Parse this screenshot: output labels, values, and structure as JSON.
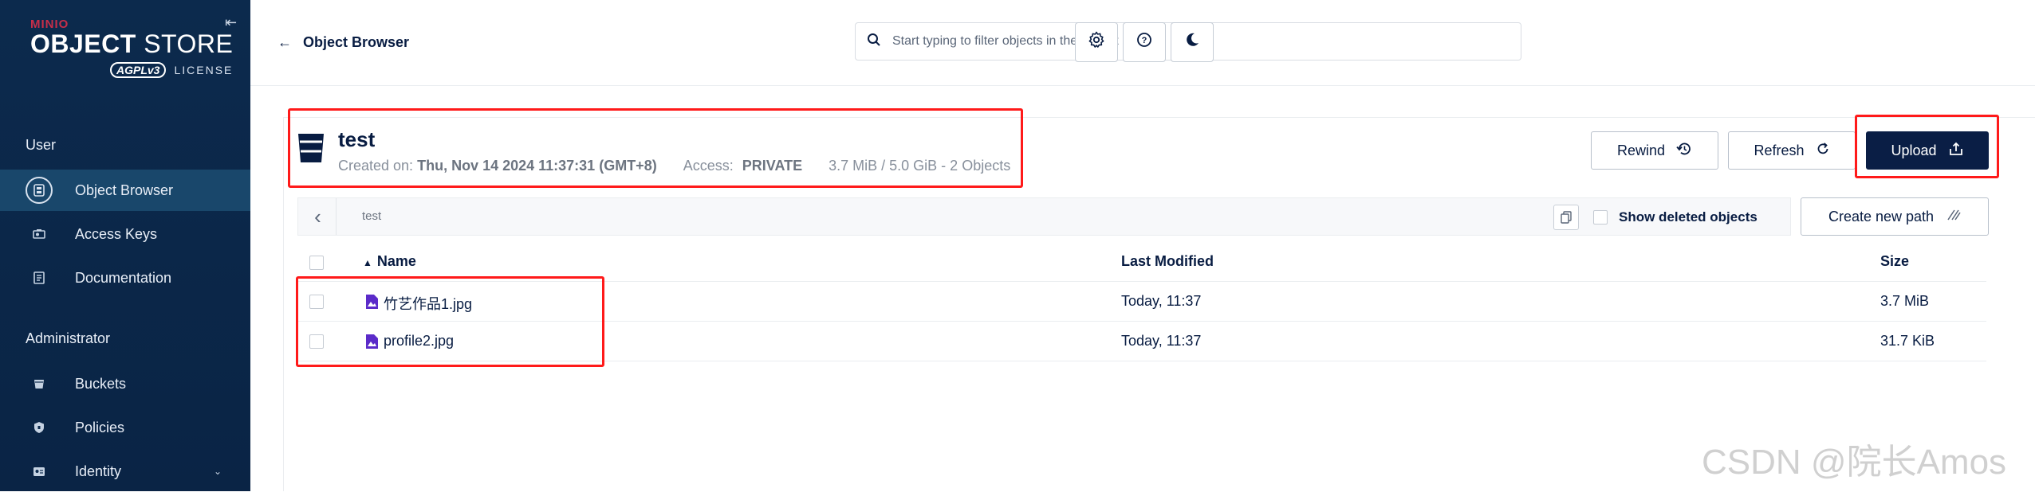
{
  "sidebar": {
    "logo": {
      "brand": "MINIO",
      "title_bold": "OBJECT",
      "title_light": " STORE",
      "badge": "AGPLv3",
      "license": "LICENSE"
    },
    "sections": [
      {
        "label": "User",
        "items": [
          {
            "label": "Object Browser",
            "icon": "object-browser-icon",
            "active": true
          },
          {
            "label": "Access Keys",
            "icon": "key-icon"
          },
          {
            "label": "Documentation",
            "icon": "document-icon"
          }
        ]
      },
      {
        "label": "Administrator",
        "items": [
          {
            "label": "Buckets",
            "icon": "bucket-icon"
          },
          {
            "label": "Policies",
            "icon": "shield-icon"
          },
          {
            "label": "Identity",
            "icon": "id-card-icon",
            "expandable": true
          }
        ]
      }
    ]
  },
  "header": {
    "back_label": "Object Browser",
    "search": {
      "placeholder": "Start typing to filter objects in the bucket",
      "value": ""
    },
    "buttons": [
      "gear-icon",
      "help-icon",
      "moon-icon"
    ]
  },
  "bucket": {
    "name": "test",
    "created_label": "Created on:",
    "created_value": "Thu, Nov 14 2024 11:37:31 (GMT+8)",
    "access_label": "Access:",
    "access_value": "PRIVATE",
    "usage": "3.7 MiB / 5.0 GiB - 2 Objects"
  },
  "actions": {
    "rewind": "Rewind",
    "refresh": "Refresh",
    "upload": "Upload"
  },
  "path": {
    "crumb": "test",
    "show_deleted": "Show deleted objects",
    "create_path": "Create new path"
  },
  "table": {
    "columns": [
      "Name",
      "Last Modified",
      "Size"
    ],
    "rows": [
      {
        "name": "竹艺作品1.jpg",
        "modified": "Today, 11:37",
        "size": "3.7 MiB"
      },
      {
        "name": "profile2.jpg",
        "modified": "Today, 11:37",
        "size": "31.7 KiB"
      }
    ]
  },
  "watermark": "CSDN @院长Amos",
  "colors": {
    "sidebar_bg": "#0c2a4d",
    "active_item_bg": "#19476b",
    "primary_button": "#0a1e45",
    "brand_red": "#c72e49",
    "highlight_box": "#ff1a1a"
  }
}
